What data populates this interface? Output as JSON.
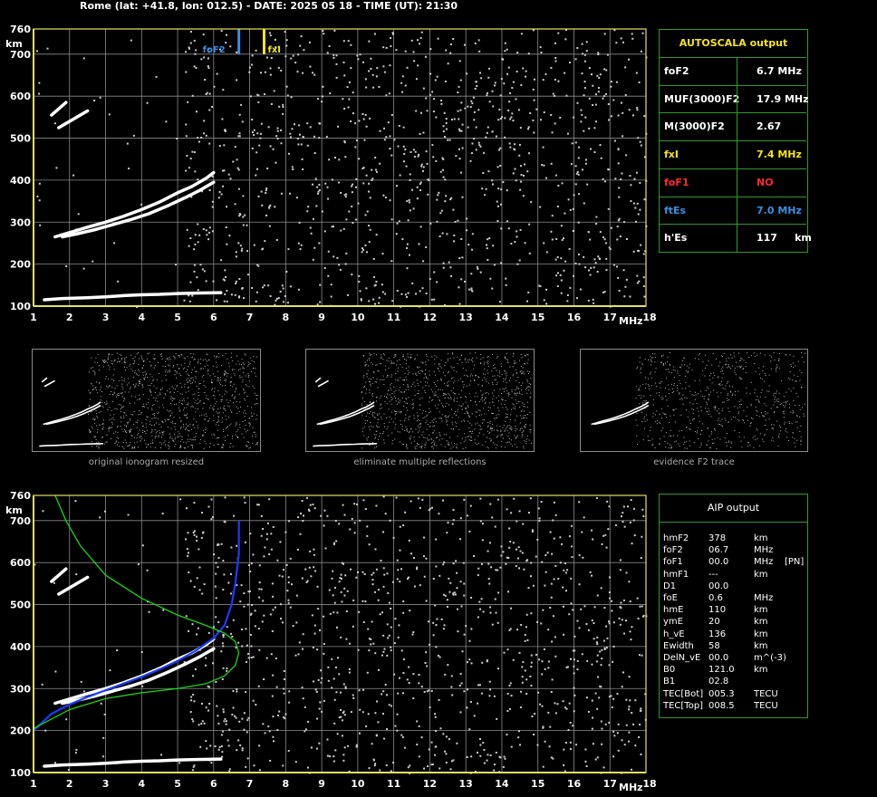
{
  "header": "Rome (lat: +41.8, lon: 012.5) - DATE: 2025 05 18 - TIME (UT): 21:30",
  "colors": {
    "frame": "#e8e060",
    "grid": "#8a8a8a",
    "panel_border": "#2e9a2e",
    "foF2": "#3b8fe0",
    "fxI": "#f4e41a",
    "foF1": "#ff2a2a",
    "ftEs": "#3b8fe0",
    "profile_blue": "#1b3bff",
    "profile_green": "#19d619"
  },
  "autoscala": {
    "title": "AUTOSCALA output",
    "rows": [
      {
        "label": "foF2",
        "value": "6.7 MHz",
        "color": "#ffffff"
      },
      {
        "label": "MUF(3000)F2",
        "value": "17.9 MHz",
        "color": "#ffffff"
      },
      {
        "label": "M(3000)F2",
        "value": "2.67",
        "color": "#ffffff"
      },
      {
        "label": "fxI",
        "value": "7.4 MHz",
        "color": "#f4e41a"
      },
      {
        "label": "foF1",
        "value": "NO",
        "color": "#ff2a2a"
      },
      {
        "label": "ftEs",
        "value": "7.0 MHz",
        "color": "#3b8fe0"
      },
      {
        "label": "h'Es",
        "value": "117     km",
        "color": "#ffffff"
      }
    ]
  },
  "aip": {
    "title": "AIP output",
    "rows": [
      {
        "label": "hmF2",
        "value": "378",
        "unit": "km",
        "extra": ""
      },
      {
        "label": "foF2",
        "value": "06.7",
        "unit": "MHz",
        "extra": ""
      },
      {
        "label": "foF1",
        "value": "00.0",
        "unit": "MHz",
        "extra": "[PN]"
      },
      {
        "label": "hmF1",
        "value": "---",
        "unit": "km",
        "extra": ""
      },
      {
        "label": "D1",
        "value": "00.0",
        "unit": "",
        "extra": ""
      },
      {
        "label": "foE",
        "value": "0.6",
        "unit": "MHz",
        "extra": ""
      },
      {
        "label": "hmE",
        "value": "110",
        "unit": "km",
        "extra": ""
      },
      {
        "label": "ymE",
        "value": "20",
        "unit": "km",
        "extra": ""
      },
      {
        "label": "h_vE",
        "value": "136",
        "unit": "km",
        "extra": ""
      },
      {
        "label": "Ewidth",
        "value": "58",
        "unit": "km",
        "extra": ""
      },
      {
        "label": "DelN_vE",
        "value": "00.0",
        "unit": "m^(-3)",
        "extra": ""
      },
      {
        "label": "B0",
        "value": "121.0",
        "unit": "km",
        "extra": ""
      },
      {
        "label": "B1",
        "value": "02.8",
        "unit": "",
        "extra": ""
      },
      {
        "label": "TEC[Bot]",
        "value": "005.3",
        "unit": "TECU",
        "extra": ""
      },
      {
        "label": "TEC[Top]",
        "value": "008.5",
        "unit": "TECU",
        "extra": ""
      }
    ]
  },
  "thumbnails": [
    {
      "caption": "original ionogram resized"
    },
    {
      "caption": "eliminate multiple reflections"
    },
    {
      "caption": "evidence F2 trace"
    }
  ],
  "chart_data": [
    {
      "type": "scatter",
      "title": "",
      "xlabel": "MHz",
      "ylabel": "km",
      "xlim": [
        1,
        18
      ],
      "ylim": [
        100,
        760
      ],
      "x_ticks": [
        1,
        2,
        3,
        4,
        5,
        6,
        7,
        8,
        9,
        10,
        11,
        12,
        13,
        14,
        15,
        16,
        17,
        18
      ],
      "y_ticks": [
        100,
        200,
        300,
        400,
        500,
        600,
        700,
        760
      ],
      "grid": true,
      "markers": [
        {
          "label": "foF2",
          "x": 6.7,
          "color": "#3b8fe0"
        },
        {
          "label": "fxI",
          "x": 7.4,
          "color": "#f4e41a"
        }
      ],
      "series": [
        {
          "x": [
            1.6,
            2.0,
            2.5,
            3.0,
            3.5,
            4.0,
            4.5,
            5.0,
            5.4,
            5.8,
            6.0
          ],
          "y": [
            265,
            275,
            288,
            300,
            314,
            330,
            348,
            370,
            385,
            405,
            418
          ]
        },
        {
          "x": [
            1.8,
            2.2,
            2.7,
            3.2,
            3.7,
            4.2,
            4.7,
            5.2,
            5.6,
            6.0
          ],
          "y": [
            265,
            272,
            282,
            294,
            306,
            320,
            338,
            358,
            375,
            395
          ]
        },
        {
          "x": [
            1.3,
            1.8,
            2.5,
            3.0,
            3.5,
            4.0,
            4.5,
            5.0,
            5.5,
            6.2
          ],
          "y": [
            115,
            118,
            120,
            122,
            125,
            127,
            128,
            130,
            131,
            132
          ]
        },
        {
          "x": [
            1.5,
            1.9
          ],
          "y": [
            555,
            585
          ]
        },
        {
          "x": [
            1.7,
            2.5
          ],
          "y": [
            525,
            565
          ]
        }
      ]
    },
    {
      "type": "scatter",
      "title": "",
      "xlabel": "MHz",
      "ylabel": "km",
      "xlim": [
        1,
        18
      ],
      "ylim": [
        100,
        760
      ],
      "x_ticks": [
        1,
        2,
        3,
        4,
        5,
        6,
        7,
        8,
        9,
        10,
        11,
        12,
        13,
        14,
        15,
        16,
        17,
        18
      ],
      "y_ticks": [
        100,
        200,
        300,
        400,
        500,
        600,
        700,
        760
      ],
      "grid": true,
      "series": [
        {
          "x": [
            1.6,
            2.0,
            2.5,
            3.0,
            3.5,
            4.0,
            4.5,
            5.0,
            5.4,
            5.8,
            6.0
          ],
          "y": [
            265,
            275,
            288,
            300,
            314,
            330,
            348,
            370,
            385,
            405,
            418
          ]
        },
        {
          "x": [
            1.8,
            2.2,
            2.7,
            3.2,
            3.7,
            4.2,
            4.7,
            5.2,
            5.6,
            6.0
          ],
          "y": [
            265,
            272,
            282,
            294,
            306,
            320,
            338,
            358,
            375,
            395
          ]
        },
        {
          "x": [
            1.3,
            1.8,
            2.5,
            3.0,
            3.5,
            4.0,
            4.5,
            5.0,
            5.5,
            6.2
          ],
          "y": [
            115,
            118,
            120,
            122,
            125,
            127,
            128,
            130,
            131,
            132
          ]
        },
        {
          "x": [
            1.5,
            1.9
          ],
          "y": [
            555,
            585
          ]
        },
        {
          "x": [
            1.7,
            2.5
          ],
          "y": [
            525,
            565
          ]
        }
      ],
      "lines": [
        {
          "color": "#1b3bff",
          "x": [
            1.0,
            1.5,
            2.0,
            2.5,
            3.0,
            3.5,
            4.0,
            4.5,
            5.0,
            5.5,
            6.0,
            6.3,
            6.5,
            6.6,
            6.7,
            6.7
          ],
          "y": [
            200,
            240,
            262,
            280,
            296,
            312,
            328,
            346,
            366,
            390,
            420,
            450,
            500,
            550,
            620,
            700
          ]
        },
        {
          "color": "#19d619",
          "x": [
            1.0,
            2.0,
            3.0,
            4.0,
            5.0,
            5.8,
            6.3,
            6.6,
            6.7,
            6.6,
            6.3,
            5.8,
            5.0,
            4.0,
            3.0,
            2.3,
            1.9,
            1.6
          ],
          "y": [
            205,
            250,
            276,
            290,
            300,
            312,
            330,
            355,
            385,
            412,
            432,
            450,
            475,
            515,
            570,
            640,
            700,
            760
          ]
        }
      ]
    }
  ]
}
